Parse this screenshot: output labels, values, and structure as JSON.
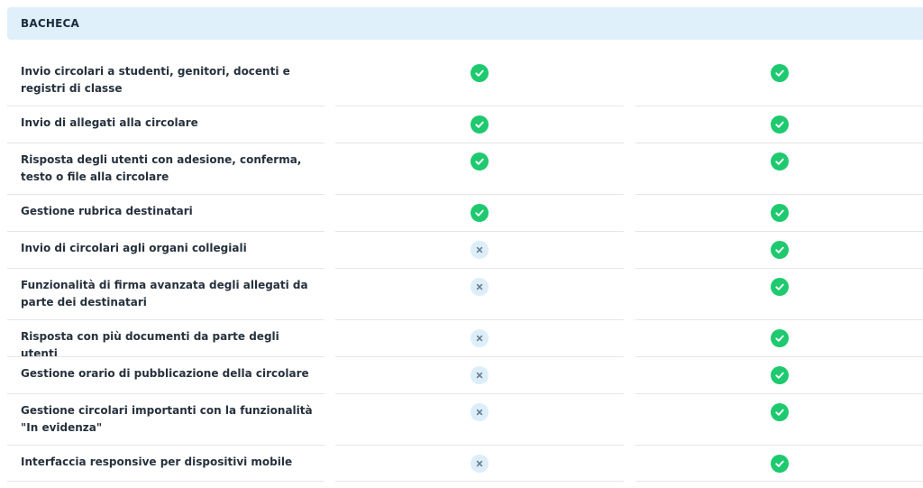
{
  "section": {
    "title": "BACHECA"
  },
  "icons": {
    "check": "check-circle-icon",
    "cross": "x-circle-icon"
  },
  "colors": {
    "check_bg": "#1ec96f",
    "cross_bg": "#dbeefa",
    "header_bg": "#dff0fb"
  },
  "rows": [
    {
      "label": "Invio circolari a studenti, genitori, docenti e registri di classe",
      "plan1": "check",
      "plan2": "check"
    },
    {
      "label": "Invio di allegati alla circolare",
      "plan1": "check",
      "plan2": "check"
    },
    {
      "label": "Risposta degli utenti con adesione, conferma, testo o file alla circolare",
      "plan1": "check",
      "plan2": "check"
    },
    {
      "label": "Gestione rubrica destinatari",
      "plan1": "check",
      "plan2": "check"
    },
    {
      "label": "Invio di circolari agli organi collegiali",
      "plan1": "cross",
      "plan2": "check"
    },
    {
      "label": "Funzionalità di firma avanzata degli allegati da parte dei destinatari",
      "plan1": "cross",
      "plan2": "check"
    },
    {
      "label": "Risposta con più documenti da parte degli utenti",
      "plan1": "cross",
      "plan2": "check"
    },
    {
      "label": "Gestione orario di pubblicazione della circolare",
      "plan1": "cross",
      "plan2": "check"
    },
    {
      "label": "Gestione circolari importanti con la funzionalità \"In evidenza\"",
      "plan1": "cross",
      "plan2": "check"
    },
    {
      "label": "Interfaccia responsive per dispositivi mobile",
      "plan1": "cross",
      "plan2": "check"
    }
  ]
}
